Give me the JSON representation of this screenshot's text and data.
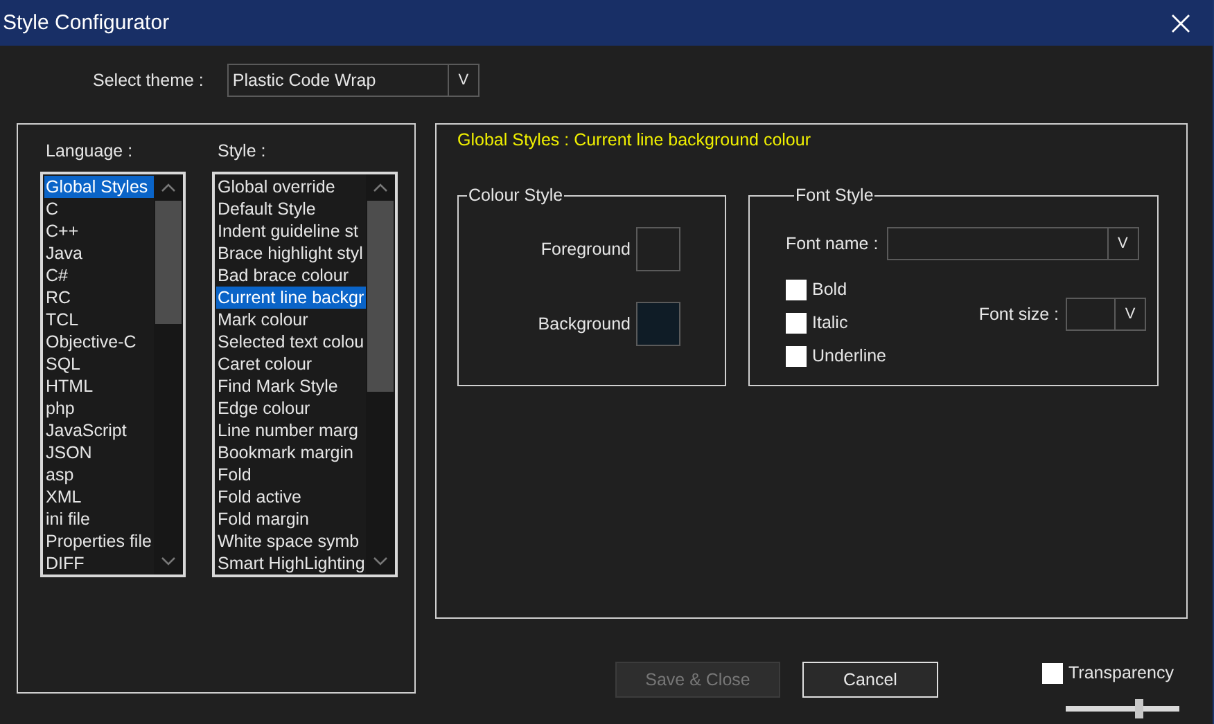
{
  "window": {
    "title": "Style Configurator"
  },
  "theme": {
    "label": "Select theme :",
    "value": "Plastic Code Wrap",
    "arrow": "V"
  },
  "language": {
    "label": "Language :",
    "items": [
      {
        "label": "Global Styles",
        "selected": true
      },
      {
        "label": "C",
        "selected": false
      },
      {
        "label": "C++",
        "selected": false
      },
      {
        "label": "Java",
        "selected": false
      },
      {
        "label": "C#",
        "selected": false
      },
      {
        "label": "RC",
        "selected": false
      },
      {
        "label": "TCL",
        "selected": false
      },
      {
        "label": "Objective-C",
        "selected": false
      },
      {
        "label": "SQL",
        "selected": false
      },
      {
        "label": "HTML",
        "selected": false
      },
      {
        "label": "php",
        "selected": false
      },
      {
        "label": "JavaScript",
        "selected": false
      },
      {
        "label": "JSON",
        "selected": false
      },
      {
        "label": "asp",
        "selected": false
      },
      {
        "label": "XML",
        "selected": false
      },
      {
        "label": "ini file",
        "selected": false
      },
      {
        "label": "Properties file",
        "selected": false
      },
      {
        "label": "DIFF",
        "selected": false
      }
    ]
  },
  "style": {
    "label": "Style :",
    "items": [
      {
        "label": "Global override",
        "selected": false
      },
      {
        "label": "Default Style",
        "selected": false
      },
      {
        "label": "Indent guideline st",
        "selected": false
      },
      {
        "label": "Brace highlight styl",
        "selected": false
      },
      {
        "label": "Bad brace colour",
        "selected": false
      },
      {
        "label": "Current line backgr",
        "selected": true
      },
      {
        "label": "Mark colour",
        "selected": false
      },
      {
        "label": "Selected text colou",
        "selected": false
      },
      {
        "label": "Caret colour",
        "selected": false
      },
      {
        "label": "Find Mark Style",
        "selected": false
      },
      {
        "label": "Edge colour",
        "selected": false
      },
      {
        "label": "Line number marg",
        "selected": false
      },
      {
        "label": "Bookmark margin",
        "selected": false
      },
      {
        "label": "Fold",
        "selected": false
      },
      {
        "label": "Fold active",
        "selected": false
      },
      {
        "label": "Fold margin",
        "selected": false
      },
      {
        "label": "White space symb",
        "selected": false
      },
      {
        "label": "Smart HighLighting",
        "selected": false
      }
    ]
  },
  "details": {
    "heading": "Global Styles : Current line background colour",
    "colour_style": {
      "title": "Colour Style",
      "swatches": [
        {
          "label": "Foreground",
          "color": "#202020"
        },
        {
          "label": "Background",
          "color": "#0f1c26"
        }
      ]
    },
    "font_style": {
      "title": "Font Style",
      "font_name": {
        "label": "Font name :",
        "arrow": "V"
      },
      "font_size": {
        "label": "Font size :",
        "arrow": "V"
      },
      "options": [
        {
          "label": "Bold",
          "checked": false
        },
        {
          "label": "Italic",
          "checked": false
        },
        {
          "label": "Underline",
          "checked": false
        }
      ]
    }
  },
  "buttons": [
    {
      "label": "Save & Close",
      "disabled": true
    },
    {
      "label": "Cancel",
      "disabled": false
    }
  ],
  "transparency": {
    "label": "Transparency",
    "checked": false,
    "level": 0.66
  }
}
